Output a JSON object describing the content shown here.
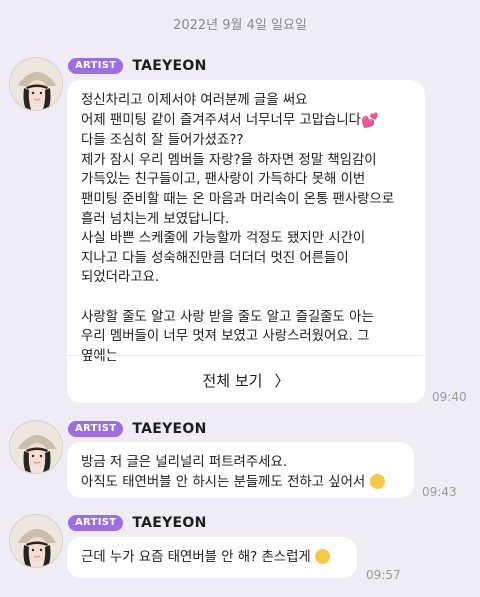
{
  "date_divider": "2022년 9월 4일 일요일",
  "messages": [
    {
      "badge": "ARTIST",
      "sender": "TAEYEON",
      "lines": [
        "정신차리고 이제서야 여러분께 글을 써요",
        "어제 팬미팅 같이 즐겨주셔서 너무너무 고맙습니다",
        "다들 조심히 잘 들어가셨죠??",
        "제가 잠시 우리 멤버들 자랑?을 하자면 정말 책임감이",
        "가득있는 친구들이고, 팬사랑이 가득하다 못해 이번",
        "팬미팅 준비할 때는 온 마음과 머리속이 온통 팬사랑으로",
        "흘러 넘치는게 보였답니다.",
        "사실 바쁜 스케줄에 가능할까 걱정도 됐지만 시간이",
        "지나고 다들 성숙해진만큼 더더더 멋진 어른들이",
        "되었더라고요.",
        "",
        "사랑할 줄도 알고 사랑 받을 줄도 알고 즐길줄도 아는",
        "우리 멤버들이 너무 멋져 보였고 사랑스러웠어요. 그",
        "옆에는"
      ],
      "heart_emoji": "💕",
      "see_more_label": "전체 보기",
      "see_more_chevron": "〉",
      "time": "09:40"
    },
    {
      "badge": "ARTIST",
      "sender": "TAEYEON",
      "lines": [
        "방금 저 글은 널리널리 퍼트려주세요.",
        "아직도 태연버블 안 하시는 분들께도 전하고 싶어서"
      ],
      "time": "09:43"
    },
    {
      "badge": "ARTIST",
      "sender": "TAEYEON",
      "lines": [
        "근데 누가 요즘 태연버블 안 해? 촌스럽게"
      ],
      "time": "09:57"
    }
  ]
}
